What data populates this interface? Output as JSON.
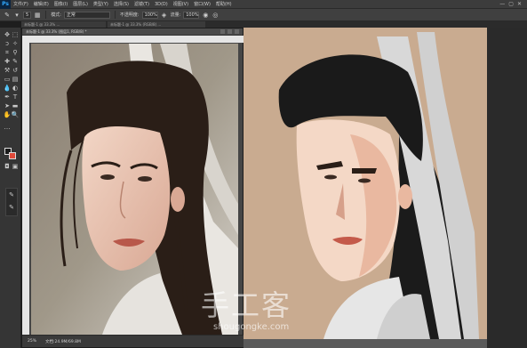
{
  "app": {
    "logo_text": "Ps"
  },
  "menu": {
    "items": [
      "文件(F)",
      "编辑(E)",
      "图像(I)",
      "图层(L)",
      "类型(Y)",
      "选择(S)",
      "滤镜(T)",
      "3D(D)",
      "视图(V)",
      "窗口(W)",
      "帮助(H)"
    ],
    "window_controls": [
      "—",
      "▢",
      "✕"
    ]
  },
  "options_bar": {
    "brush_size": "5",
    "mode_label": "模式:",
    "mode_value": "正常",
    "opacity_label": "不透明度:",
    "opacity_value": "100%",
    "flow_label": "流量:",
    "flow_value": "100%"
  },
  "tabs": [
    {
      "label": "未标题-1 @ 33.3% ..."
    },
    {
      "label": "未标题-1 @ 33.3% (RGB/8) ..."
    }
  ],
  "document": {
    "title": "未标题-1 @ 33.3% (图层1, RGB/8) *",
    "zoom": "25%",
    "file_info": "文档:24.9M/69.8M"
  },
  "watermark": {
    "chinese": "手工客",
    "english": "shougongke.com"
  },
  "colors": {
    "foreground": "#1a1a1a",
    "background": "#e04a3a",
    "canvas_right": "#c9ab90"
  }
}
